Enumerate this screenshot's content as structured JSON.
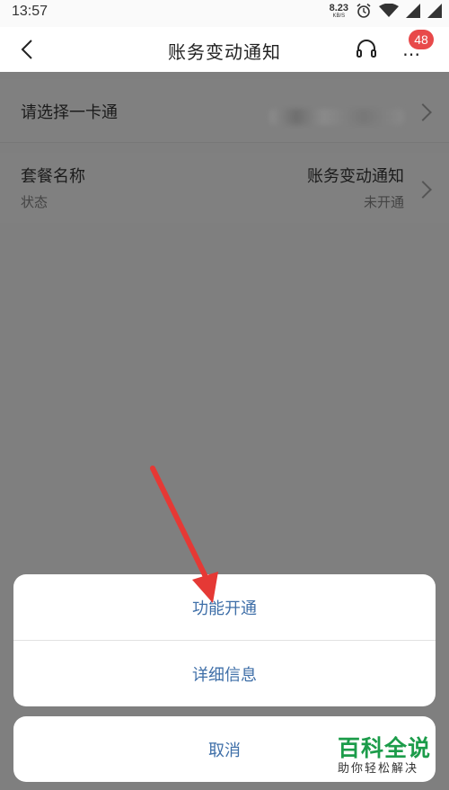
{
  "status_bar": {
    "time": "13:57",
    "net_speed": "8.23",
    "net_unit": "KB/S"
  },
  "header": {
    "title": "账务变动通知",
    "badge_count": "48"
  },
  "rows": [
    {
      "label": "请选择一卡通",
      "value": ""
    },
    {
      "label": "套餐名称",
      "value": "账务变动通知",
      "sub_label": "状态",
      "sub_value": "未开通"
    }
  ],
  "sheet": {
    "item1": "功能开通",
    "item2": "详细信息",
    "cancel": "取消"
  },
  "watermark": {
    "main": "百科全说",
    "sub": "助你轻松解决"
  },
  "colors": {
    "accent": "#3f6fa8",
    "badge": "#e8494a",
    "arrow": "#e53935",
    "watermark": "#1c9c4a"
  }
}
